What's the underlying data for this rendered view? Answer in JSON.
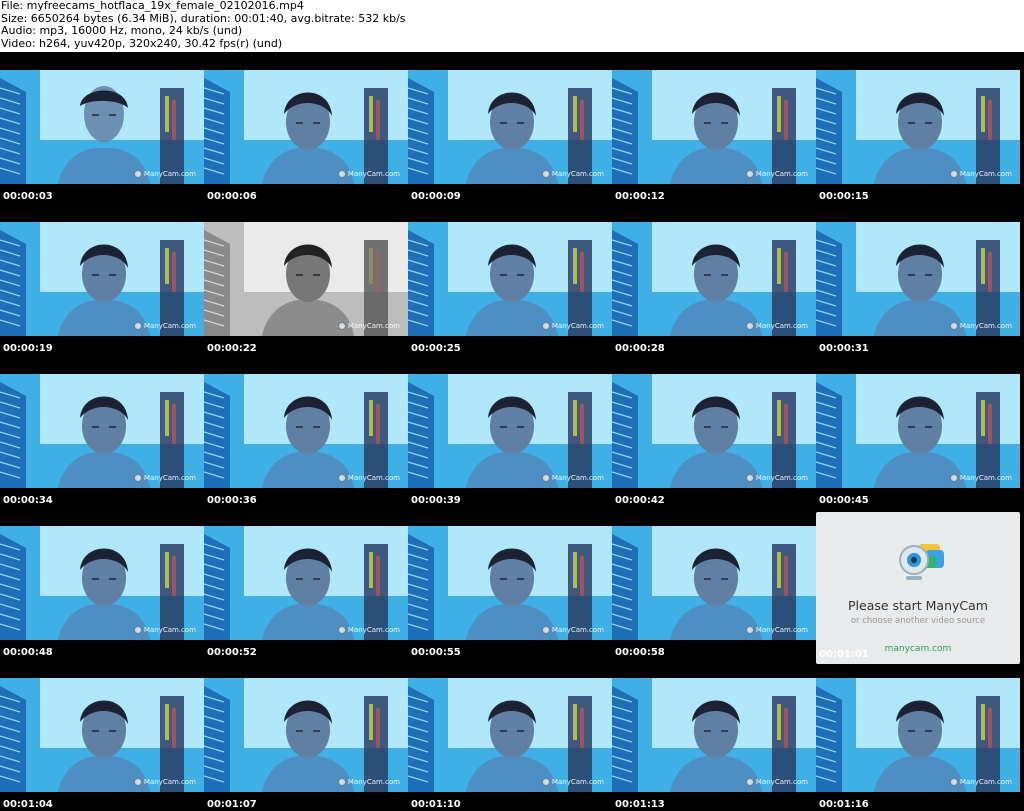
{
  "header": {
    "file_line": "File: myfreecams_hotflaca_19x_female_02102016.mp4",
    "size_line": "Size: 6650264 bytes (6.34 MiB), duration: 00:01:40, avg.bitrate: 532 kb/s",
    "audio_line": "Audio: mp3, 16000 Hz, mono, 24 kb/s (und)",
    "video_line": "Video: h264, yuv420p, 320x240, 30.42 fps(r) (und)"
  },
  "watermark_text": "ManyCam.com",
  "manycam_card": {
    "title": "Please start ManyCam",
    "subtitle": "or choose another video source",
    "link": "manycam.com"
  },
  "colors": {
    "frame_blue": "#48b7e8",
    "frame_light": "#b9ecfb",
    "background": "#000000",
    "manycam_green": "#24a255"
  },
  "frames": [
    {
      "timestamp": "00:00:03",
      "variant": "blur"
    },
    {
      "timestamp": "00:00:06",
      "variant": "blue"
    },
    {
      "timestamp": "00:00:09",
      "variant": "blue"
    },
    {
      "timestamp": "00:00:12",
      "variant": "blue"
    },
    {
      "timestamp": "00:00:15",
      "variant": "blue"
    },
    {
      "timestamp": "00:00:19",
      "variant": "blue"
    },
    {
      "timestamp": "00:00:22",
      "variant": "gray"
    },
    {
      "timestamp": "00:00:25",
      "variant": "blue"
    },
    {
      "timestamp": "00:00:28",
      "variant": "blue"
    },
    {
      "timestamp": "00:00:31",
      "variant": "blue"
    },
    {
      "timestamp": "00:00:34",
      "variant": "blue"
    },
    {
      "timestamp": "00:00:36",
      "variant": "blue"
    },
    {
      "timestamp": "00:00:39",
      "variant": "blue"
    },
    {
      "timestamp": "00:00:42",
      "variant": "blue"
    },
    {
      "timestamp": "00:00:45",
      "variant": "blue"
    },
    {
      "timestamp": "00:00:48",
      "variant": "blue"
    },
    {
      "timestamp": "00:00:52",
      "variant": "blue"
    },
    {
      "timestamp": "00:00:55",
      "variant": "blue"
    },
    {
      "timestamp": "00:00:58",
      "variant": "blue"
    },
    {
      "timestamp": "00:01:01",
      "variant": "manycam"
    },
    {
      "timestamp": "00:01:04",
      "variant": "blue"
    },
    {
      "timestamp": "00:01:07",
      "variant": "blue"
    },
    {
      "timestamp": "00:01:10",
      "variant": "blue"
    },
    {
      "timestamp": "00:01:13",
      "variant": "blue"
    },
    {
      "timestamp": "00:01:16",
      "variant": "blue"
    }
  ]
}
